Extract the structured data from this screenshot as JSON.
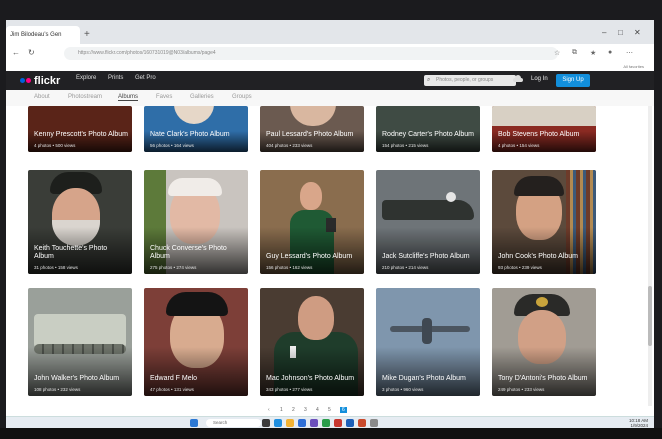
{
  "browser": {
    "tab_title": "Jim Bilodeau's Gen",
    "new_tab": "+",
    "url": "https://www.flickr.com/photos/160731019@N03/albums/page4",
    "favorites_label": "All favorites",
    "win_min": "–",
    "win_max": "□",
    "win_close": "✕"
  },
  "flickr": {
    "logo": "flickr",
    "nav": [
      "Explore",
      "Prints",
      "Get Pro"
    ],
    "search_placeholder": "Photos, people, or groups",
    "login": "Log In",
    "signup": "Sign Up"
  },
  "subnav": [
    "About",
    "Photostream",
    "Albums",
    "Faves",
    "Galleries",
    "Groups"
  ],
  "albums": [
    {
      "title": "Kenny Prescott's Photo Album",
      "meta": "4 photos  •  500 views",
      "bg": "#5a2418"
    },
    {
      "title": "Nate Clark's Photo Album",
      "meta": "56 photos  •  164 views",
      "bg": "#2f6ea8"
    },
    {
      "title": "Paul Lessard's Photo Album",
      "meta": "404 photos  •  233 views",
      "bg": "#6b5a50"
    },
    {
      "title": "Rodney Carter's Photo Album",
      "meta": "154 photos  •  215 views",
      "bg": "#3f4b44"
    },
    {
      "title": "Bob Stevens Photo Album",
      "meta": "4 photos  •  154 views",
      "bg": "#8a2a22"
    },
    {
      "title": "Keith Touchette's Photo Album",
      "meta": "31 photos  •  158 views",
      "bg": "#3a3d38"
    },
    {
      "title": "Chuck Converse's Photo Album",
      "meta": "275 photos  •  274 views",
      "bg": "#c9c4bf"
    },
    {
      "title": "Guy Lessard's Photo Album",
      "meta": "156 photos  •  162 views",
      "bg": "#8a6d4e"
    },
    {
      "title": "Jack Sutcliffe's Photo Album",
      "meta": "210 photos  •  214 views",
      "bg": "#6e7478"
    },
    {
      "title": "John Cook's Photo Album",
      "meta": "93 photos  •  239 views",
      "bg": "#5c4a3c"
    },
    {
      "title": "John Walker's Photo Album",
      "meta": "108 photos  •  232 views",
      "bg": "#9aa09a"
    },
    {
      "title": "Edward F Melo",
      "meta": "47 photos  •  131 views",
      "bg": "#7d3f38"
    },
    {
      "title": "Mac Johnson's Photo Album",
      "meta": "343 photos  •  277 views",
      "bg": "#4a3c32"
    },
    {
      "title": "Mike Dugan's Photo Album",
      "meta": "3 photos  •  960 views",
      "bg": "#7f96ad"
    },
    {
      "title": "Tony D'Antoni's Photo Album",
      "meta": "249 photos  •  233 views",
      "bg": "#a19c94"
    }
  ],
  "pager": [
    "‹",
    "1",
    "2",
    "3",
    "4",
    "5",
    "6"
  ],
  "taskbar": {
    "search": "Search",
    "time": "10:18 AM",
    "date": "1/9/2024"
  }
}
